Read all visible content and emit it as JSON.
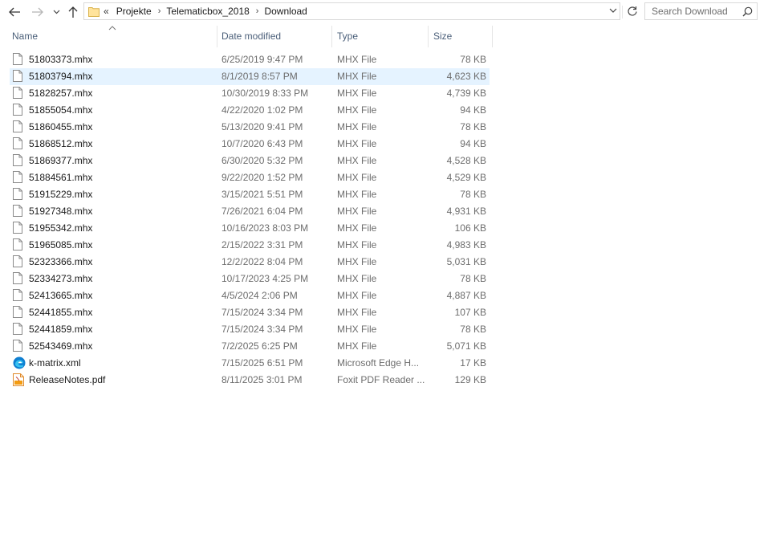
{
  "nav": {
    "back_icon": "arrow-left-icon",
    "forward_icon": "arrow-right-icon",
    "recent_icon": "chevron-down-icon",
    "up_icon": "arrow-up-icon"
  },
  "address": {
    "overflow": "«",
    "crumbs": [
      "Projekte",
      "Telematicbox_2018",
      "Download"
    ],
    "separator": "›"
  },
  "search": {
    "placeholder": "Search Download"
  },
  "columns": {
    "name": "Name",
    "date": "Date modified",
    "type": "Type",
    "size": "Size"
  },
  "files": [
    {
      "name": "51803373.mhx",
      "date": "6/25/2019 9:47 PM",
      "type": "MHX File",
      "size": "78 KB",
      "icon": "file-icon"
    },
    {
      "name": "51803794.mhx",
      "date": "8/1/2019 8:57 PM",
      "type": "MHX File",
      "size": "4,623 KB",
      "icon": "file-icon",
      "selected": true
    },
    {
      "name": "51828257.mhx",
      "date": "10/30/2019 8:33 PM",
      "type": "MHX File",
      "size": "4,739 KB",
      "icon": "file-icon"
    },
    {
      "name": "51855054.mhx",
      "date": "4/22/2020 1:02 PM",
      "type": "MHX File",
      "size": "94 KB",
      "icon": "file-icon"
    },
    {
      "name": "51860455.mhx",
      "date": "5/13/2020 9:41 PM",
      "type": "MHX File",
      "size": "78 KB",
      "icon": "file-icon"
    },
    {
      "name": "51868512.mhx",
      "date": "10/7/2020 6:43 PM",
      "type": "MHX File",
      "size": "94 KB",
      "icon": "file-icon"
    },
    {
      "name": "51869377.mhx",
      "date": "6/30/2020 5:32 PM",
      "type": "MHX File",
      "size": "4,528 KB",
      "icon": "file-icon"
    },
    {
      "name": "51884561.mhx",
      "date": "9/22/2020 1:52 PM",
      "type": "MHX File",
      "size": "4,529 KB",
      "icon": "file-icon"
    },
    {
      "name": "51915229.mhx",
      "date": "3/15/2021 5:51 PM",
      "type": "MHX File",
      "size": "78 KB",
      "icon": "file-icon"
    },
    {
      "name": "51927348.mhx",
      "date": "7/26/2021 6:04 PM",
      "type": "MHX File",
      "size": "4,931 KB",
      "icon": "file-icon"
    },
    {
      "name": "51955342.mhx",
      "date": "10/16/2023 8:03 PM",
      "type": "MHX File",
      "size": "106 KB",
      "icon": "file-icon"
    },
    {
      "name": "51965085.mhx",
      "date": "2/15/2022 3:31 PM",
      "type": "MHX File",
      "size": "4,983 KB",
      "icon": "file-icon"
    },
    {
      "name": "52323366.mhx",
      "date": "12/2/2022 8:04 PM",
      "type": "MHX File",
      "size": "5,031 KB",
      "icon": "file-icon"
    },
    {
      "name": "52334273.mhx",
      "date": "10/17/2023 4:25 PM",
      "type": "MHX File",
      "size": "78 KB",
      "icon": "file-icon"
    },
    {
      "name": "52413665.mhx",
      "date": "4/5/2024 2:06 PM",
      "type": "MHX File",
      "size": "4,887 KB",
      "icon": "file-icon"
    },
    {
      "name": "52441855.mhx",
      "date": "7/15/2024 3:34 PM",
      "type": "MHX File",
      "size": "107 KB",
      "icon": "file-icon"
    },
    {
      "name": "52441859.mhx",
      "date": "7/15/2024 3:34 PM",
      "type": "MHX File",
      "size": "78 KB",
      "icon": "file-icon"
    },
    {
      "name": "52543469.mhx",
      "date": "7/2/2025 6:25 PM",
      "type": "MHX File",
      "size": "5,071 KB",
      "icon": "file-icon"
    },
    {
      "name": "k-matrix.xml",
      "date": "7/15/2025 6:51 PM",
      "type": "Microsoft Edge H...",
      "size": "17 KB",
      "icon": "edge-icon"
    },
    {
      "name": "ReleaseNotes.pdf",
      "date": "8/11/2025 3:01 PM",
      "type": "Foxit PDF Reader ...",
      "size": "129 KB",
      "icon": "pdf-icon"
    }
  ],
  "colors": {
    "selected_row": "#e5f3ff",
    "header_text": "#4c607a",
    "meta_text": "#6d6d6d"
  }
}
